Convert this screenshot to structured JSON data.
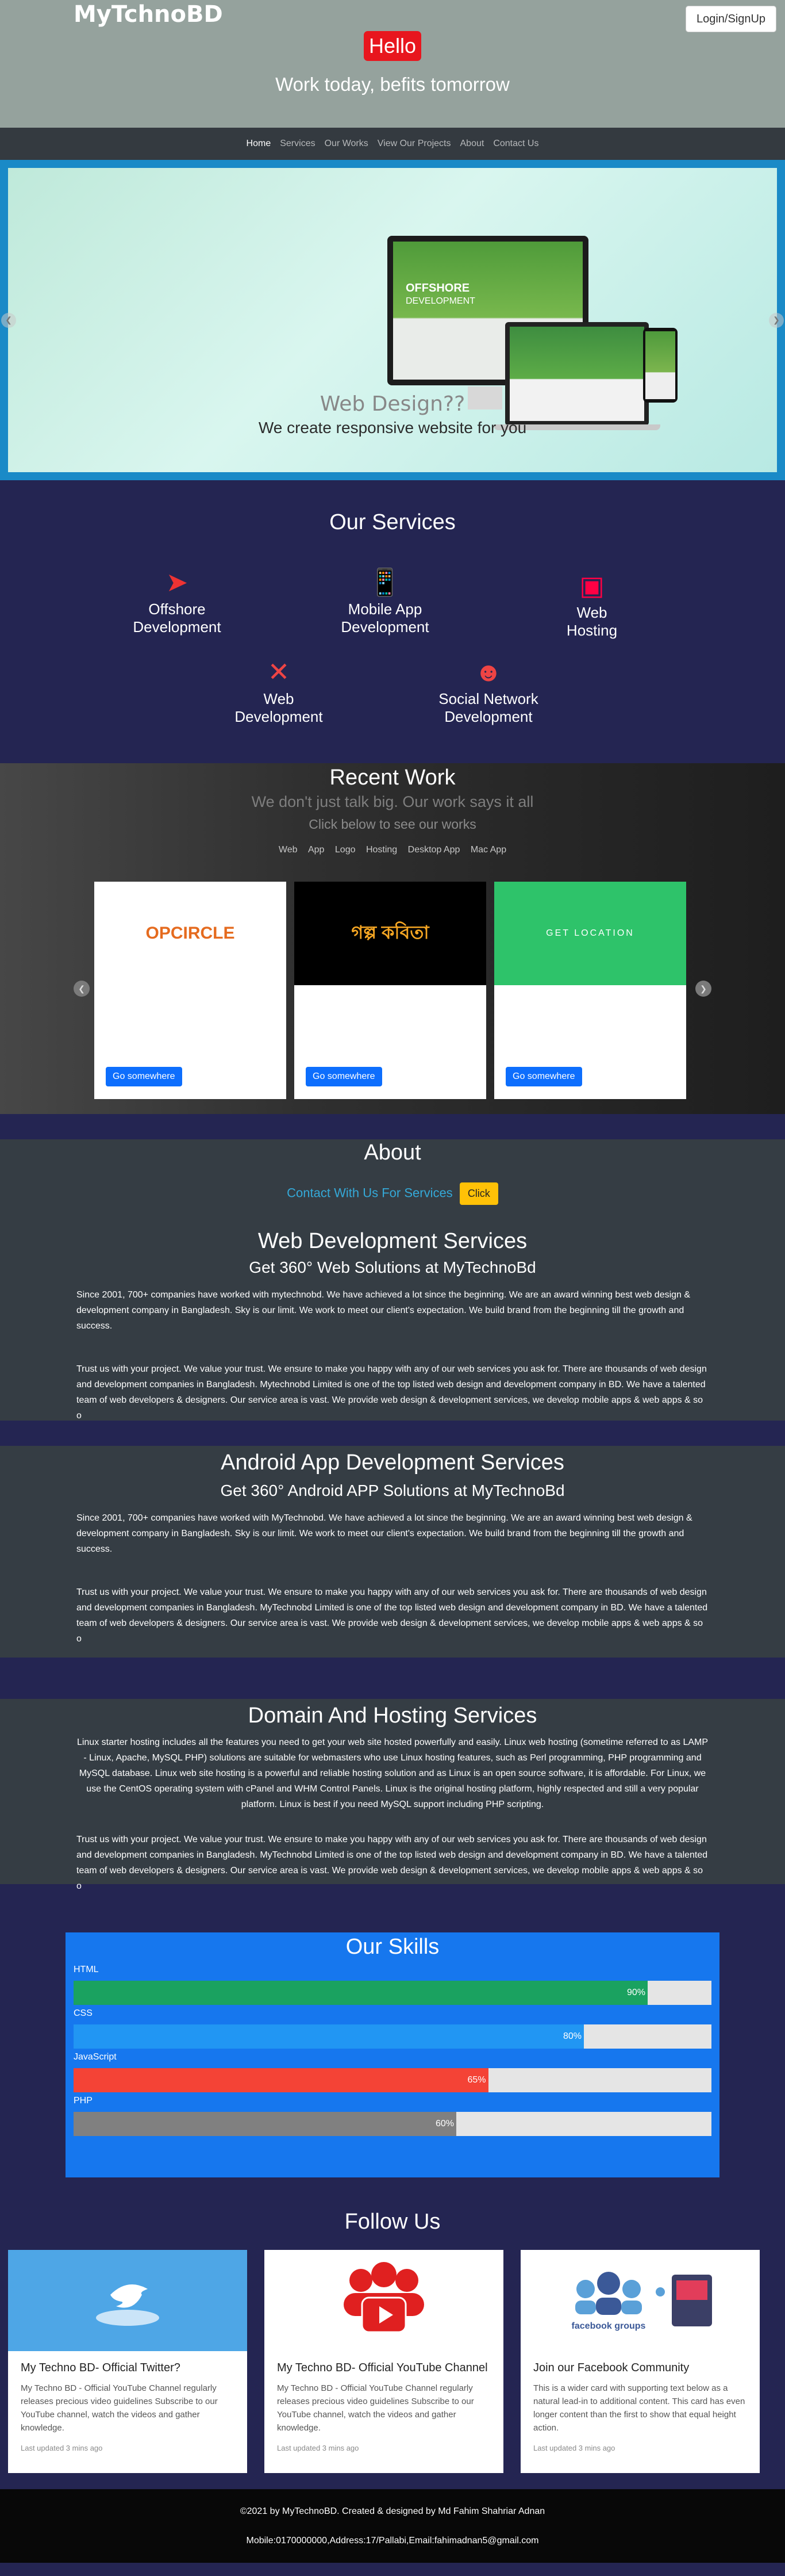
{
  "header": {
    "brand": "MyTchnoBD",
    "login_label": "Login/SignUp",
    "hello": "Hello",
    "tagline": "Work today, befits tomorrow",
    "bg_color": "#95a29d"
  },
  "nav": {
    "items": [
      "Home",
      "Services",
      "Our Works",
      "View Our Projects",
      "About",
      "Contact Us"
    ]
  },
  "carousel": {
    "title": "Web Design??",
    "subtitle": "We create responsive website for you",
    "screen_text": "OFFSHORE",
    "screen_text2": "DEVELOPMENT"
  },
  "services": {
    "title": "Our Services",
    "items": [
      {
        "label": "Offshore Development",
        "icon": "paper-plane-icon"
      },
      {
        "label": "Mobile App Development",
        "icon": "mobile-hand-icon"
      },
      {
        "label": "Web Hosting",
        "icon": "web-hosting-icon"
      },
      {
        "label": "Web Development",
        "icon": "web-development-icon"
      },
      {
        "label": "Social Network Development",
        "icon": "social-network-icon"
      }
    ]
  },
  "recent_work": {
    "title": "Recent Work",
    "subtitle": "We don't just talk big. Our work says it all",
    "subtitle2": "Click below to see our works",
    "filters": [
      "Web",
      "App",
      "Logo",
      "Hosting",
      "Desktop App",
      "Mac App"
    ],
    "cards": [
      {
        "logo": "OPCIRCLE",
        "button": "Go somewhere"
      },
      {
        "logo": "গল্প কবিতা",
        "button": "Go somewhere"
      },
      {
        "logo": "GET LOCATION",
        "button": "Go somewhere"
      }
    ]
  },
  "about": {
    "title": "About",
    "contact_text": "Contact With Us For Services",
    "click_label": "Click",
    "web": {
      "title": "Web Development Services",
      "subtitle": "Get 360° Web Solutions at MyTechnoBd",
      "p1": "Since 2001, 700+ companies have worked with mytechnobd. We have achieved a lot since the beginning. We are an award winning best web design & development company in Bangladesh. Sky is our limit. We work to meet our client's expectation. We build brand from the beginning till the growth and success.",
      "p2": "Trust us with your project. We value your trust. We ensure to make you happy with any of our web services you ask for. There are thousands of web design and development companies in Bangladesh. Mytechnobd Limited is one of the top listed web design and development company in BD. We have a talented team of web developers & designers. Our service area is vast. We provide web design & development services, we develop mobile apps & web apps & so o"
    },
    "android": {
      "title": "Android App Development Services",
      "subtitle": "Get 360° Android APP Solutions at MyTechnoBd",
      "p1": "Since 2001, 700+ companies have worked with MyTechnobd. We have achieved a lot since the beginning. We are an award winning best web design & development company in Bangladesh. Sky is our limit. We work to meet our client's expectation. We build brand from the beginning till the growth and success.",
      "p2": "Trust us with your project. We value your trust. We ensure to make you happy with any of our web services you ask for. There are thousands of web design and development companies in Bangladesh. MyTechnobd Limited is one of the top listed web design and development company in BD. We have a talented team of web developers & designers. Our service area is vast. We provide web design & development services, we develop mobile apps & web apps & so o"
    },
    "hosting": {
      "title": "Domain And Hosting Services",
      "p1": "Linux starter hosting includes all the features you need to get your web site hosted powerfully and easily. Linux web hosting (sometime referred to as LAMP - Linux, Apache, MySQL PHP) solutions are suitable for webmasters who use Linux hosting features, such as Perl programming, PHP programming and MySQL database. Linux web site hosting is a powerful and reliable hosting solution and as Linux is an open source software, it is affordable. For Linux, we use the CentOS operating system with cPanel and WHM Control Panels. Linux is the original hosting platform, highly respected and still a very popular platform. Linux is best if you need MySQL support including PHP scripting.",
      "p2": "Trust us with your project. We value your trust. We ensure to make you happy with any of our web services you ask for. There are thousands of web design and development companies in Bangladesh. MyTechnobd Limited is one of the top listed web design and development company in BD. We have a talented team of web developers & designers. Our service area is vast. We provide web design & development services, we develop mobile apps & web apps & so o"
    }
  },
  "skills": {
    "title": "Our Skills",
    "items": [
      {
        "label": "HTML",
        "value": 90,
        "text": "90%",
        "color": "#1aa260"
      },
      {
        "label": "CSS",
        "value": 80,
        "text": "80%",
        "color": "#2196f3"
      },
      {
        "label": "JavaScript",
        "value": 65,
        "text": "65%",
        "color": "#f44336"
      },
      {
        "label": "PHP",
        "value": 60,
        "text": "60%",
        "color": "#808080"
      }
    ]
  },
  "follow": {
    "title": "Follow Us",
    "cards": [
      {
        "title": "My Techno BD- Official Twitter?",
        "text": "My Techno BD - Official YouTube Channel regularly releases precious video guidelines Subscribe to our YouTube channel, watch the videos and gather knowledge.",
        "updated": "Last updated 3 mins ago",
        "icon": "twitter-icon"
      },
      {
        "title": "My Techno BD- Official YouTube Channel",
        "text": "My Techno BD - Official YouTube Channel regularly releases precious video guidelines Subscribe to our YouTube channel, watch the videos and gather knowledge.",
        "updated": "Last updated 3 mins ago",
        "icon": "youtube-icon"
      },
      {
        "title": "Join our Facebook Community",
        "text": "This is a wider card with supporting text below as a natural lead-in to additional content. This card has even longer content than the first to show that equal height action.",
        "updated": "Last updated 3 mins ago",
        "icon": "facebook-groups-icon"
      }
    ]
  },
  "footer": {
    "line1": "©2021 by MyTechnoBD. Created & designed by Md Fahim Shahriar Adnan",
    "line2": "Mobile:0170000000,Address:17/Pallabi,Email:fahimadnan5@gmail.com"
  }
}
